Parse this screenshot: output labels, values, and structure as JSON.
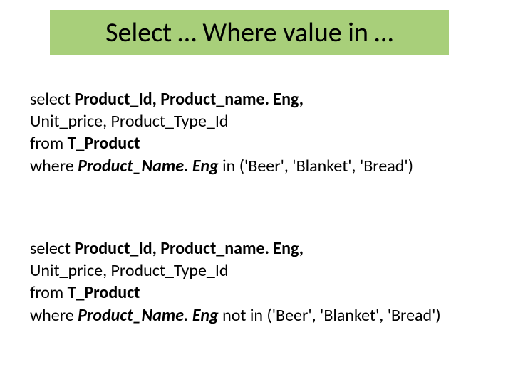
{
  "title": "Select … Where value in …",
  "query1": {
    "select_kw": "select ",
    "select_cols_bold": "Product_Id, Product_name. Eng,",
    "line2": "Unit_price, Product_Type_Id",
    "from_kw": "from ",
    "from_table": "T_Product",
    "where_kw": "where ",
    "where_col": "Product_Name. Eng",
    "where_rest": " in ('Beer', 'Blanket', 'Bread')"
  },
  "query2": {
    "select_kw": "select ",
    "select_cols_bold": "Product_Id, Product_name. Eng,",
    "line2": "Unit_price, Product_Type_Id",
    "from_kw": "from ",
    "from_table": "T_Product",
    "where_kw": "where ",
    "where_col": "Product_Name. Eng",
    "where_rest": " not in ('Beer', 'Blanket', 'Bread')"
  }
}
